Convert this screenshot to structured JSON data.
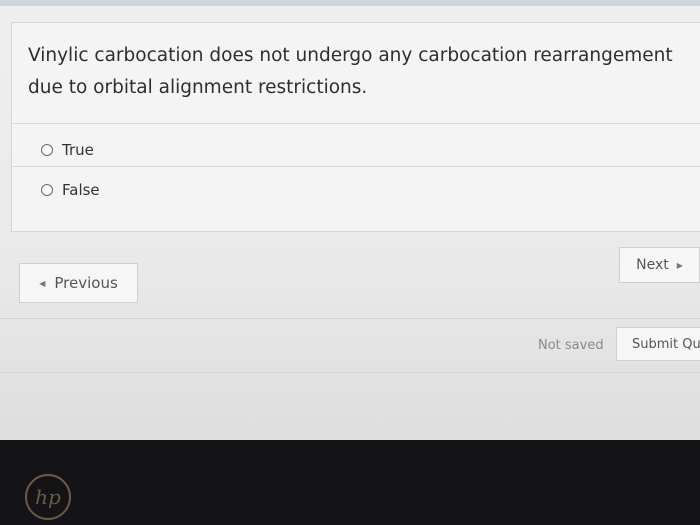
{
  "question": {
    "text": "Vinylic carbocation does not undergo any carbocation rearrangement due to orbital alignment restrictions."
  },
  "options": [
    {
      "label": "True"
    },
    {
      "label": "False"
    }
  ],
  "navigation": {
    "previous_label": "Previous",
    "next_label": "Next"
  },
  "footer": {
    "status_text": "Not saved",
    "submit_label": "Submit Qu"
  },
  "device": {
    "logo_text": "hp"
  }
}
